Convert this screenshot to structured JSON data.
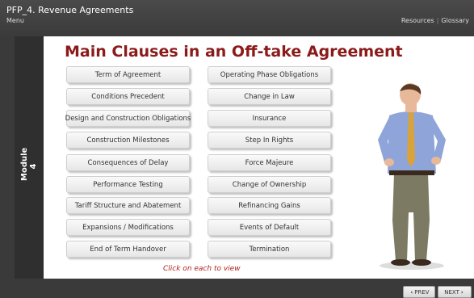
{
  "header": {
    "course_title": "PFP_4. Revenue Agreements",
    "menu_label": "Menu",
    "resources_label": "Resources",
    "separator": "|",
    "glossary_label": "Glossary"
  },
  "sidebar": {
    "module_label": "Module 4"
  },
  "main": {
    "title": "Main Clauses in an Off-take Agreement",
    "hint": "Click on each to view",
    "left_clauses": [
      "Term of Agreement",
      "Conditions Precedent",
      "Design and Construction Obligations",
      "Construction Milestones",
      "Consequences of Delay",
      "Performance Testing",
      "Tariff Structure and Abatement",
      "Expansions / Modifications",
      "End of Term Handover"
    ],
    "right_clauses": [
      "Operating Phase Obligations",
      "Change in Law",
      "Insurance",
      "Step In Rights",
      "Force Majeure",
      "Change of Ownership",
      "Refinancing Gains",
      "Events of Default",
      "Termination"
    ]
  },
  "footer": {
    "prev_label": "PREV",
    "prev_arrow": "‹",
    "next_label": "NEXT",
    "next_arrow": "›"
  },
  "colors": {
    "title": "#8b1a1a",
    "hint": "#b02020",
    "chrome": "#3a3a3a"
  }
}
